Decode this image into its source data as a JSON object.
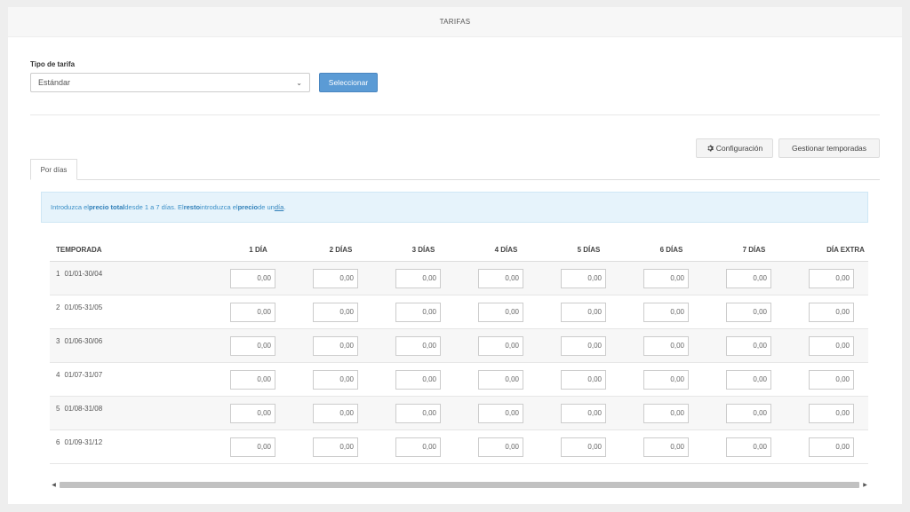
{
  "header": {
    "title": "TARIFAS"
  },
  "tariff_type": {
    "label": "Tipo de tarifa",
    "selected": "Estándar",
    "button": "Seleccionar"
  },
  "actions": {
    "config_icon": "gear-icon",
    "config_label": "Configuración",
    "seasons_label": "Gestionar temporadas"
  },
  "tabs": [
    {
      "label": "Por días"
    }
  ],
  "info": {
    "part1": "Introduzca el ",
    "bold1": "precio total",
    "part2": " desde 1 a 7 días. El ",
    "bold2": "resto",
    "part3": " introduzca el ",
    "bold3": "precio",
    "part4": " de un ",
    "link": "día",
    "part5": "."
  },
  "table": {
    "headers": [
      "TEMPORADA",
      "1 DÍA",
      "2 DÍAS",
      "3 DÍAS",
      "4 DÍAS",
      "5 DÍAS",
      "6 DÍAS",
      "7 DÍAS",
      "DÍA EXTRA"
    ],
    "rows": [
      {
        "num": "1",
        "range": "01/01-30/04",
        "values": [
          "0,00",
          "0,00",
          "0,00",
          "0,00",
          "0,00",
          "0,00",
          "0,00",
          "0,00"
        ]
      },
      {
        "num": "2",
        "range": "01/05-31/05",
        "values": [
          "0,00",
          "0,00",
          "0,00",
          "0,00",
          "0,00",
          "0,00",
          "0,00",
          "0,00"
        ]
      },
      {
        "num": "3",
        "range": "01/06-30/06",
        "values": [
          "0,00",
          "0,00",
          "0,00",
          "0,00",
          "0,00",
          "0,00",
          "0,00",
          "0,00"
        ]
      },
      {
        "num": "4",
        "range": "01/07-31/07",
        "values": [
          "0,00",
          "0,00",
          "0,00",
          "0,00",
          "0,00",
          "0,00",
          "0,00",
          "0,00"
        ]
      },
      {
        "num": "5",
        "range": "01/08-31/08",
        "values": [
          "0,00",
          "0,00",
          "0,00",
          "0,00",
          "0,00",
          "0,00",
          "0,00",
          "0,00"
        ]
      },
      {
        "num": "6",
        "range": "01/09-31/12",
        "values": [
          "0,00",
          "0,00",
          "0,00",
          "0,00",
          "0,00",
          "0,00",
          "0,00",
          "0,00"
        ]
      }
    ]
  },
  "colors": {
    "primary": "#5b9bd5",
    "info_bg": "#e6f3fb",
    "info_text": "#3a8fc7"
  }
}
